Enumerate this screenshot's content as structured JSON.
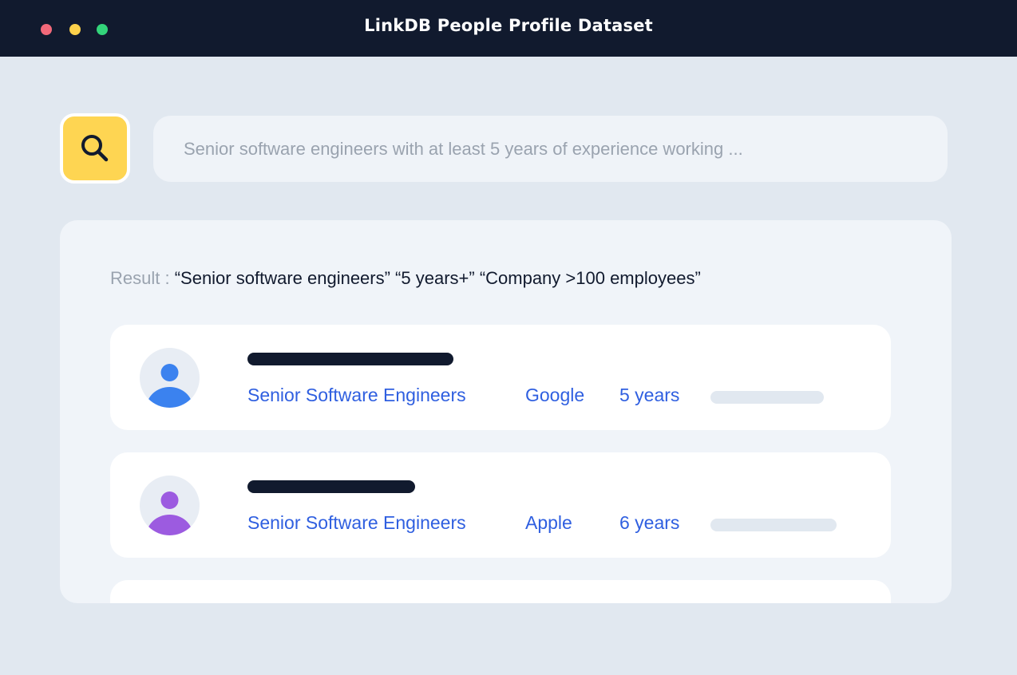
{
  "window": {
    "title": "LinkDB People Profile Dataset"
  },
  "search": {
    "placeholder": "Senior software engineers with at least 5 years of experience working ..."
  },
  "result": {
    "label": "Result : ",
    "query": "“Senior software engineers” “5 years+” “Company >100 employees”"
  },
  "profiles": [
    {
      "role": "Senior Software Engineers",
      "company": "Google",
      "years": "5 years",
      "avatar_color": "#3b82ef"
    },
    {
      "role": "Senior Software Engineers",
      "company": "Apple",
      "years": "6 years",
      "avatar_color": "#9c5be0"
    }
  ],
  "colors": {
    "titlebar": "#111a2e",
    "accent_yellow": "#fed552",
    "link_blue": "#2f5fe0",
    "background": "#e1e8f0"
  },
  "icons": {
    "search_button": "search-icon",
    "avatar": "user-icon"
  }
}
